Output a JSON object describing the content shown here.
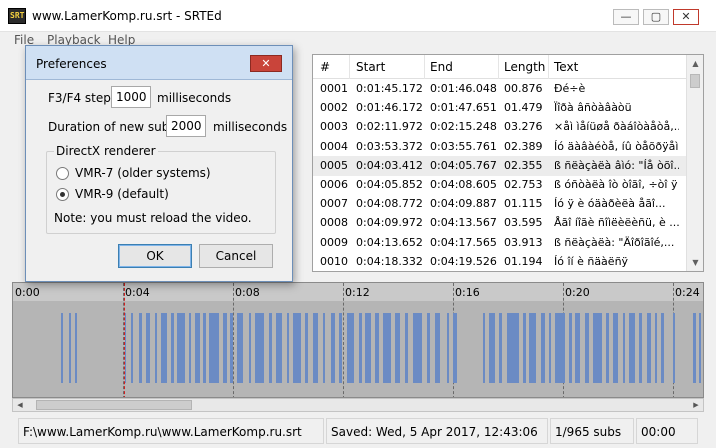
{
  "window": {
    "title": "www.LamerKomp.ru.srt - SRTEd",
    "app_icon_text": "SRT",
    "minimize": "—",
    "maximize": "▢",
    "close": "✕"
  },
  "menu": [
    "File",
    "Playback",
    "Help"
  ],
  "dialog": {
    "title": "Preferences",
    "close": "✕",
    "step_label": "F3/F4 step",
    "step_value": "1000",
    "step_unit": "milliseconds",
    "duration_label": "Duration of new subs",
    "duration_value": "2000",
    "duration_unit": "milliseconds",
    "group_title": "DirectX renderer",
    "radio_vmr7": "VMR-7 (older systems)",
    "radio_vmr9": "VMR-9 (default)",
    "selected_renderer": "VMR-9 (default)",
    "note": "Note: you must reload the video.",
    "ok_label": "OK",
    "cancel_label": "Cancel"
  },
  "table": {
    "columns": [
      "#",
      "Start",
      "End",
      "Length",
      "Text"
    ],
    "rows": [
      [
        "0001",
        "0:01:45.172",
        "0:01:46.048",
        "00.876",
        "Ðé÷è"
      ],
      [
        "0002",
        "0:01:46.172",
        "0:01:47.651",
        "01.479",
        "Ïîðà âñòàâàòü"
      ],
      [
        "0003",
        "0:02:11.972",
        "0:02:15.248",
        "03.276",
        "×åì ìåíüøå ðàáîòàåòå,..."
      ],
      [
        "0004",
        "0:03:53.372",
        "0:03:55.761",
        "02.389",
        "Íó äàâàéòå, íû òåõðÿåì..."
      ],
      [
        "0005",
        "0:04:03.412",
        "0:04:05.767",
        "02.355",
        "ß ñëàçàëà âìó: \"Íå òõî..."
      ],
      [
        "0006",
        "0:04:05.852",
        "0:04:08.605",
        "02.753",
        "ß óñòàëà îò òîãî, ÷òî ÿ ..."
      ],
      [
        "0007",
        "0:04:08.772",
        "0:04:09.887",
        "01.115",
        "Íó ÿ è óäàðèëà åãî..."
      ],
      [
        "0008",
        "0:04:09.972",
        "0:04:13.567",
        "03.595",
        "Åãî íîãè ñîìëèëèñü, è ..."
      ],
      [
        "0009",
        "0:04:13.652",
        "0:04:17.565",
        "03.913",
        "ß ñëàçàëà: \"Äîðîãîé,..."
      ],
      [
        "0010",
        "0:04:18.332",
        "0:04:19.526",
        "01.194",
        "Íó îí è ñäàëñÿ"
      ]
    ],
    "selected_row": "0005"
  },
  "timeline": {
    "ticks": [
      "0:00",
      "0:04",
      "0:08",
      "0:12",
      "0:16",
      "0:20",
      "0:24"
    ],
    "colors": {
      "background": "#b5b5b5",
      "subtitle_block": "#6b8bc4",
      "playhead": "#d12020"
    }
  },
  "watermark": "LamerKomp.ru",
  "status": {
    "file": "F:\\www.LamerKomp.ru\\www.LamerKomp.ru.srt",
    "saved": "Saved: Wed, 5 Apr 2017, 12:43:06",
    "count": "1/965 subs",
    "extra": "00:00"
  }
}
